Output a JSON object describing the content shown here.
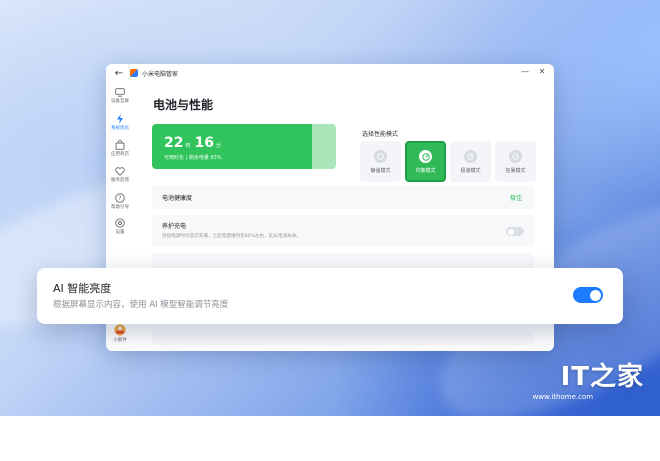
{
  "window": {
    "title": "小米电脑管家",
    "controls": {
      "minimize": "—",
      "maximize": "☐",
      "close": "✕"
    }
  },
  "sidebar": {
    "items": [
      {
        "label": "设备互联",
        "icon": "monitor-icon",
        "active": false
      },
      {
        "label": "系统优化",
        "icon": "lightning-icon",
        "active": true
      },
      {
        "label": "应用商店",
        "icon": "shopping-bag-icon",
        "active": false
      },
      {
        "label": "服务反馈",
        "icon": "heart-icon",
        "active": false
      },
      {
        "label": "帮助引导",
        "icon": "help-icon",
        "active": false
      },
      {
        "label": "设置",
        "icon": "gear-icon",
        "active": false
      },
      {
        "label": "小部件",
        "icon": "widget-icon",
        "active": false
      }
    ]
  },
  "page": {
    "title": "电池与性能"
  },
  "battery": {
    "hours": "22",
    "hours_unit": "时",
    "minutes": "16",
    "minutes_unit": "分",
    "subtitle": "可用时长 | 剩余电量 83%",
    "level_percent": 83
  },
  "modes": {
    "heading": "选择性能模式",
    "options": [
      {
        "label": "静谧模式",
        "active": false
      },
      {
        "label": "均衡模式",
        "active": true
      },
      {
        "label": "极速模式",
        "active": false
      },
      {
        "label": "狂暴模式",
        "active": false
      }
    ]
  },
  "settings": {
    "health": {
      "label": "电池健康度",
      "value": "极佳"
    },
    "care_charge": {
      "label": "养护充电",
      "description": "连接电源时仅首次充满，之后电量维持在80%左右，延长电池寿命。",
      "enabled": false
    }
  },
  "overlay": {
    "title": "AI 智能亮度",
    "description": "根据屏幕显示内容，使用 AI 模型智能调节亮度",
    "enabled": true
  },
  "watermark": {
    "logo": "IT之家",
    "url": "www.ithome.com"
  },
  "colors": {
    "accent": "#1c7bff",
    "battery_green": "#32c45c",
    "link_green": "#2fba57"
  }
}
